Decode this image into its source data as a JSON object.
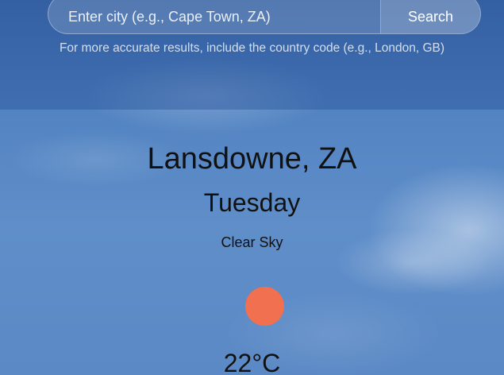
{
  "search": {
    "placeholder": "Enter city (e.g., Cape Town, ZA)",
    "button_label": "Search",
    "hint": "For more accurate results, include the country code (e.g., London, GB)"
  },
  "weather": {
    "location": "Lansdowne, ZA",
    "day": "Tuesday",
    "condition": "Clear Sky",
    "icon": "sun-icon",
    "temperature": "22°C"
  },
  "colors": {
    "sun": "#f0704f",
    "background": "#5584c2",
    "text": "#111111"
  }
}
